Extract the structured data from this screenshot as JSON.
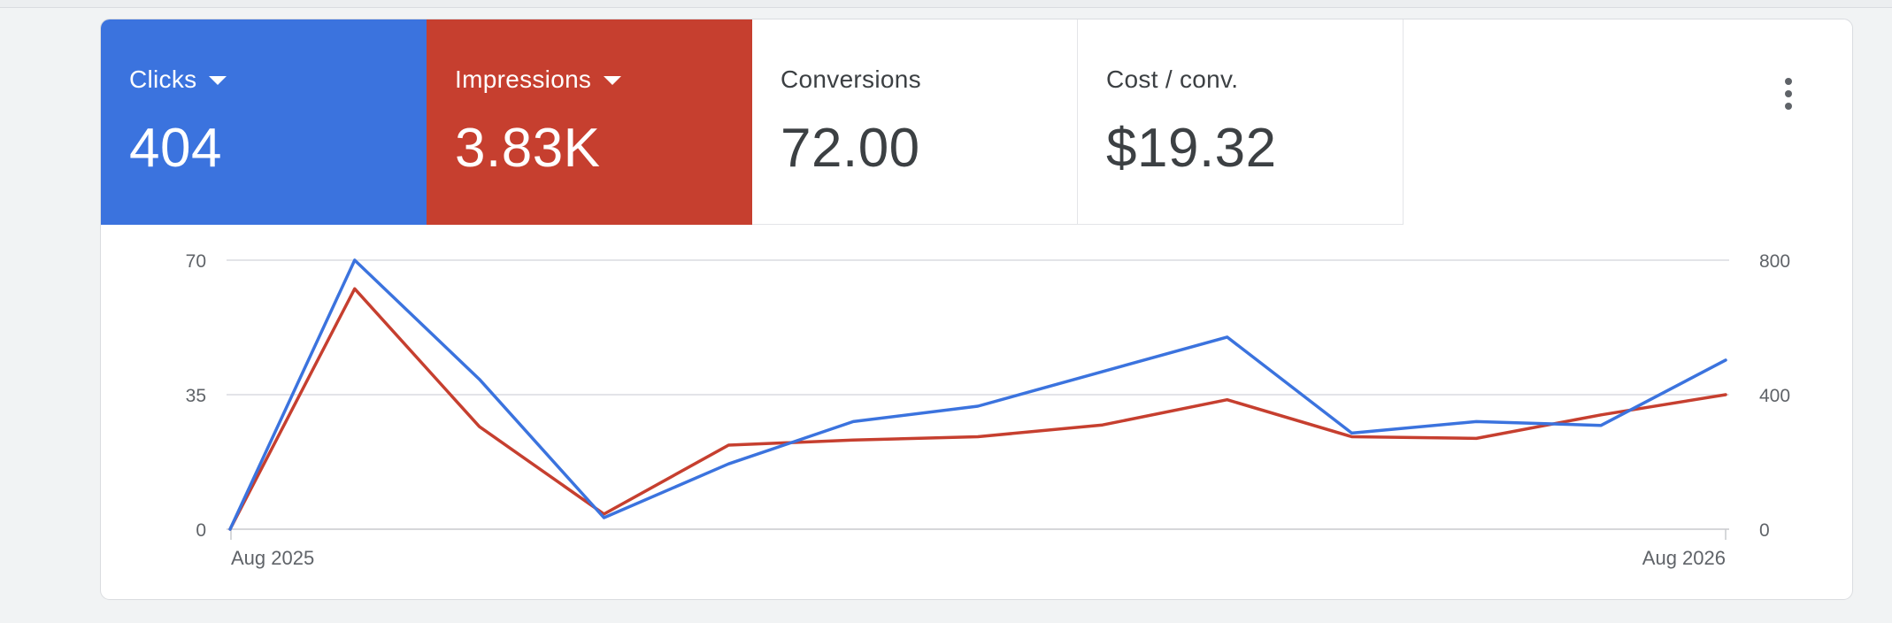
{
  "metrics": [
    {
      "label": "Clicks",
      "value": "404",
      "color": "#3b73de"
    },
    {
      "label": "Impressions",
      "value": "3.83K",
      "color": "#c63f2f"
    },
    {
      "label": "Conversions",
      "value": "72.00"
    },
    {
      "label": "Cost / conv.",
      "value": "$19.32"
    }
  ],
  "more_icon": "more-vert-icon",
  "chart_data": {
    "type": "line",
    "x": [
      "Aug 2025",
      "",
      "",
      "",
      "",
      "",
      "",
      "",
      "",
      "",
      "",
      "",
      "Aug 2026"
    ],
    "x_tick_labels": [
      "Aug 2025",
      "Aug 2026"
    ],
    "series": [
      {
        "name": "Clicks",
        "axis": "left",
        "color": "#3b73de",
        "values": [
          0,
          70,
          39,
          3,
          17,
          28,
          32,
          41,
          50,
          25,
          28,
          27,
          44
        ]
      },
      {
        "name": "Impressions",
        "axis": "right",
        "color": "#c63f2f",
        "values": [
          0,
          715,
          305,
          45,
          250,
          265,
          275,
          310,
          385,
          275,
          270,
          340,
          400
        ]
      }
    ],
    "y_left": {
      "ylim": [
        0,
        70
      ],
      "ticks": [
        "0",
        "35",
        "70"
      ]
    },
    "y_right": {
      "ylim": [
        0,
        800
      ],
      "ticks": [
        "0",
        "400",
        "800"
      ]
    },
    "grid": true
  }
}
